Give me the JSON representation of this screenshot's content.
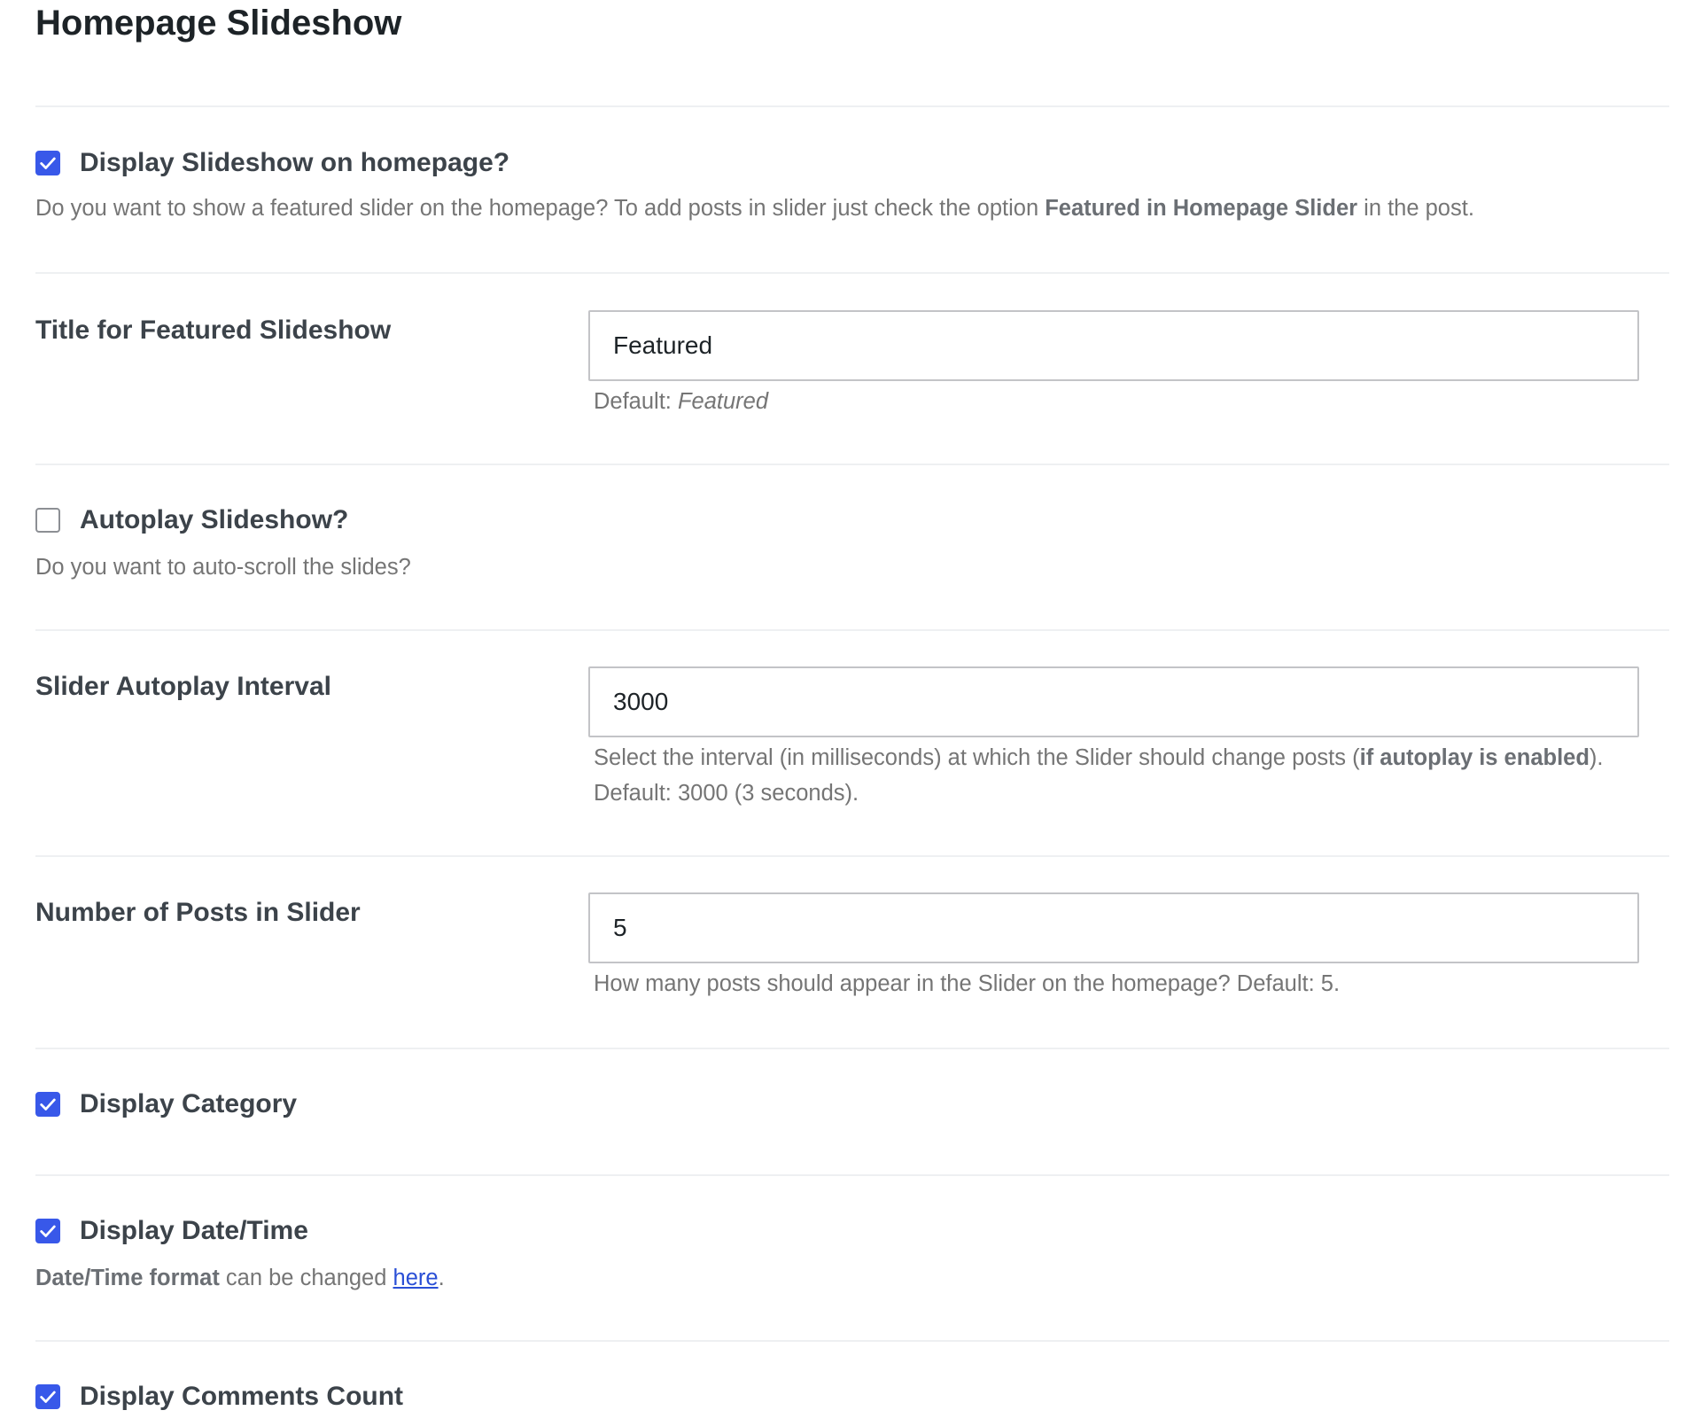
{
  "page": {
    "title": "Homepage Slideshow"
  },
  "display_slideshow": {
    "checked": true,
    "label": "Display Slideshow on homepage?",
    "desc_prefix": "Do you want to show a featured slider on the homepage? To add posts in slider just check the option ",
    "desc_bold": "Featured in Homepage Slider",
    "desc_suffix": " in the post."
  },
  "title_field": {
    "label": "Title for Featured Slideshow",
    "value": "Featured",
    "help_prefix": "Default: ",
    "help_italic": "Featured"
  },
  "autoplay": {
    "checked": false,
    "label": "Autoplay Slideshow?",
    "desc": "Do you want to auto-scroll the slides?"
  },
  "interval_field": {
    "label": "Slider Autoplay Interval",
    "value": "3000",
    "help_prefix": "Select the interval (in milliseconds) at which the Slider should change posts (",
    "help_bold": "if autoplay is enabled",
    "help_suffix": "). Default: 3000 (3 seconds)."
  },
  "posts_field": {
    "label": "Number of Posts in Slider",
    "value": "5",
    "help": "How many posts should appear in the Slider on the homepage? Default: 5."
  },
  "display_category": {
    "checked": true,
    "label": "Display Category"
  },
  "display_datetime": {
    "checked": true,
    "label": "Display Date/Time",
    "desc_bold": "Date/Time format",
    "desc_middle": " can be changed ",
    "desc_link": "here",
    "desc_end": "."
  },
  "display_comments": {
    "checked": true,
    "label": "Display Comments Count"
  },
  "colors": {
    "accent": "#3858e9",
    "link": "#2a4fd6",
    "label": "#3c434a",
    "muted": "#757575",
    "divider": "#eef0f2",
    "input_border": "#c3c4c7"
  }
}
